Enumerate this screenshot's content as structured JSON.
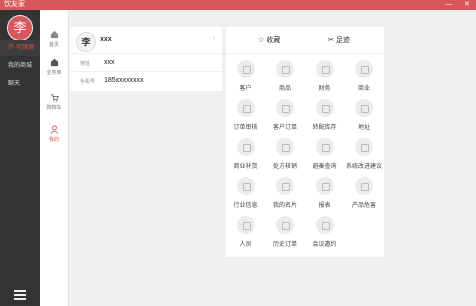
{
  "window": {
    "title": "饮友家",
    "min": "—",
    "close": "✕"
  },
  "sidebar": {
    "avatar_char": "李",
    "items": [
      {
        "label": "开·宅铺酒"
      },
      {
        "label": "我的商城"
      },
      {
        "label": "聊天"
      }
    ]
  },
  "nav": {
    "items": [
      {
        "label": "首页"
      },
      {
        "label": "业务库"
      },
      {
        "label": "购物车"
      },
      {
        "label": "我的"
      }
    ]
  },
  "profile": {
    "avatar_char": "李",
    "name": "xxx",
    "arrow": "›",
    "address_label": "地址",
    "address_value": "xxx",
    "phone_label": "手机号",
    "phone_value": "185xxxxxxxx"
  },
  "panel": {
    "tabs": [
      {
        "label": "☆ 收藏"
      },
      {
        "label": "足迹"
      }
    ],
    "grid": [
      {
        "label": "客户",
        "icon": "user-icon"
      },
      {
        "label": "商品",
        "icon": "box-icon"
      },
      {
        "label": "财务",
        "icon": "finance-icon"
      },
      {
        "label": "商业",
        "icon": "share-icon"
      },
      {
        "label": "订单审核",
        "icon": "clipboard-icon"
      },
      {
        "label": "客户订单",
        "icon": "document-icon"
      },
      {
        "label": "转配库存",
        "icon": "warehouse-icon"
      },
      {
        "label": "地址",
        "icon": "location-icon"
      },
      {
        "label": "商业补货",
        "icon": "handshake-icon"
      },
      {
        "label": "处方核销",
        "icon": "check-icon"
      },
      {
        "label": "避秦查询",
        "icon": "eye-icon"
      },
      {
        "label": "系统改进建议",
        "icon": "suggestion-icon"
      },
      {
        "label": "行业信息",
        "icon": "info-icon"
      },
      {
        "label": "我的名片",
        "icon": "card-icon"
      },
      {
        "label": "报表",
        "icon": "chart-icon"
      },
      {
        "label": "产品危害",
        "icon": "product-icon"
      },
      {
        "label": "人员",
        "icon": "people-icon"
      },
      {
        "label": "历史订单",
        "icon": "history-icon"
      },
      {
        "label": "会议邀约",
        "icon": "meeting-icon"
      }
    ]
  }
}
